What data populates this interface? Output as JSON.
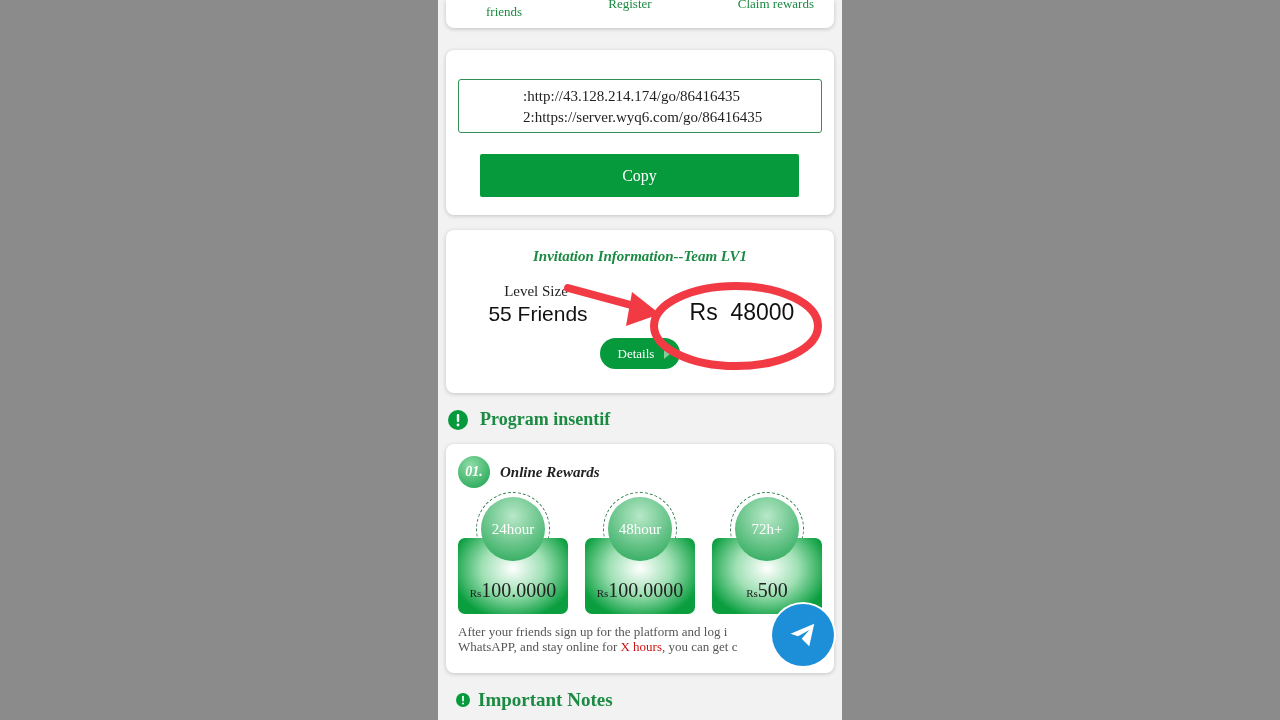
{
  "top_steps": [
    {
      "label": "friends"
    },
    {
      "label": "Register"
    },
    {
      "label": "Claim rewards"
    }
  ],
  "invite_links": {
    "lines": [
      ":http://43.128.214.174/go/86416435",
      "2:https://server.wyq6.com/go/86416435"
    ],
    "copy_button": "Copy"
  },
  "invitation_info": {
    "title": "Invitation Information--Team LV1",
    "level_label": "Level Size",
    "level_value": "55 Friends",
    "commission_value": "Rs  48000",
    "details_button": "Details"
  },
  "program_heading": "Program insentif",
  "online_rewards": {
    "number": "01.",
    "title": "Online Rewards",
    "tiers": [
      {
        "duration": "24hour",
        "currency": "Rs",
        "amount": "100.0000"
      },
      {
        "duration": "48hour",
        "currency": "Rs",
        "amount": "100.0000"
      },
      {
        "duration": "72h+",
        "currency": "Rs",
        "amount": "500"
      }
    ],
    "description_line_1": "After your friends sign up for the platform and log i",
    "description_line_2_before": "WhatsAPP, and stay online for ",
    "description_line_2_highlight": "X hours",
    "description_line_2_after": ", you can get c"
  },
  "notes_heading": "Important Notes"
}
